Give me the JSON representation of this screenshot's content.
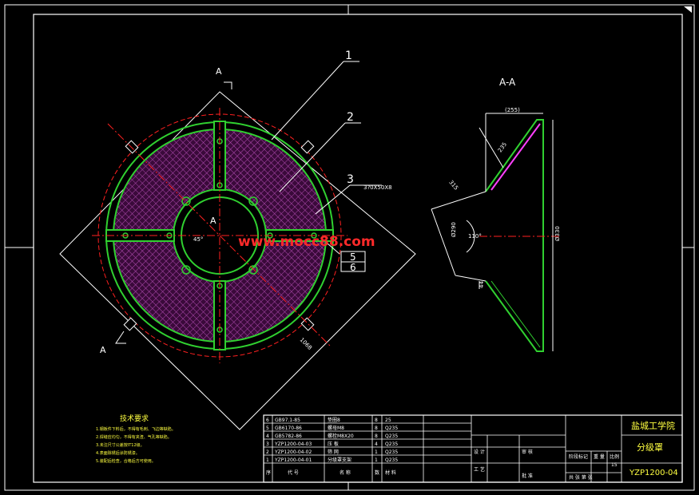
{
  "drawing": {
    "section_label_top": "A",
    "section_label_bottom": "A",
    "center_label": "A",
    "section_view_title": "A-A",
    "watermark": "www.mocc88.com",
    "balloons": [
      "1",
      "2",
      "3"
    ],
    "balloon_bottom": [
      "5",
      "6"
    ],
    "note_3": "3?0X50X8",
    "dim_diameter_1": "1068",
    "dim_angle_center": "45°",
    "dim_top_width": "(255)",
    "dim_slant_upper": "235",
    "dim_slant_left": "315",
    "dim_angle_side": "110°",
    "dim_left_dia": "Ø290",
    "dim_right_dia": "Ø330",
    "dim_small": "44"
  },
  "notes": {
    "title": "技术要求",
    "lines": [
      "1.钢板件下料后，不得有毛刺、飞边等缺陷。",
      "2.焊缝应均匀，不得有夹渣、气孔等缺陷。",
      "3.未注尺寸公差按IT12级。",
      "4.表面除锈后涂防锈漆。",
      "5.装配后检查，合格后方可使用。"
    ]
  },
  "parts": [
    {
      "no": "6",
      "code": "GB97.1-85",
      "name": "垫圈8",
      "qty": "8",
      "material": "25"
    },
    {
      "no": "5",
      "code": "GB6170-86",
      "name": "螺母M8",
      "qty": "8",
      "material": "Q235"
    },
    {
      "no": "4",
      "code": "GB5782-86",
      "name": "螺栓M8X20",
      "qty": "8",
      "material": "Q235"
    },
    {
      "no": "3",
      "code": "YZP1200-04-03",
      "name": "压 板",
      "qty": "4",
      "material": "Q235"
    },
    {
      "no": "2",
      "code": "YZP1200-04-02",
      "name": "筛 网",
      "qty": "1",
      "material": "Q235"
    },
    {
      "no": "1",
      "code": "YZP1200-04-01",
      "name": "分级罩支架",
      "qty": "1",
      "material": "Q235"
    }
  ],
  "parts_header": {
    "no": "序",
    "code": "代 号",
    "name": "名 称",
    "qty": "数",
    "material": "材 料"
  },
  "title_block": {
    "school": "盐城工学院",
    "part_name": "分级罩",
    "drawing_no": "YZP1200-04",
    "scale": "15",
    "mark_label": "阶段标记",
    "weight_label": "重 量",
    "scale_label": "比例",
    "sheet_label": "共 张 第 张",
    "designer": "设 计",
    "check": "审 核",
    "process": "工 艺",
    "approve": "批 准"
  }
}
